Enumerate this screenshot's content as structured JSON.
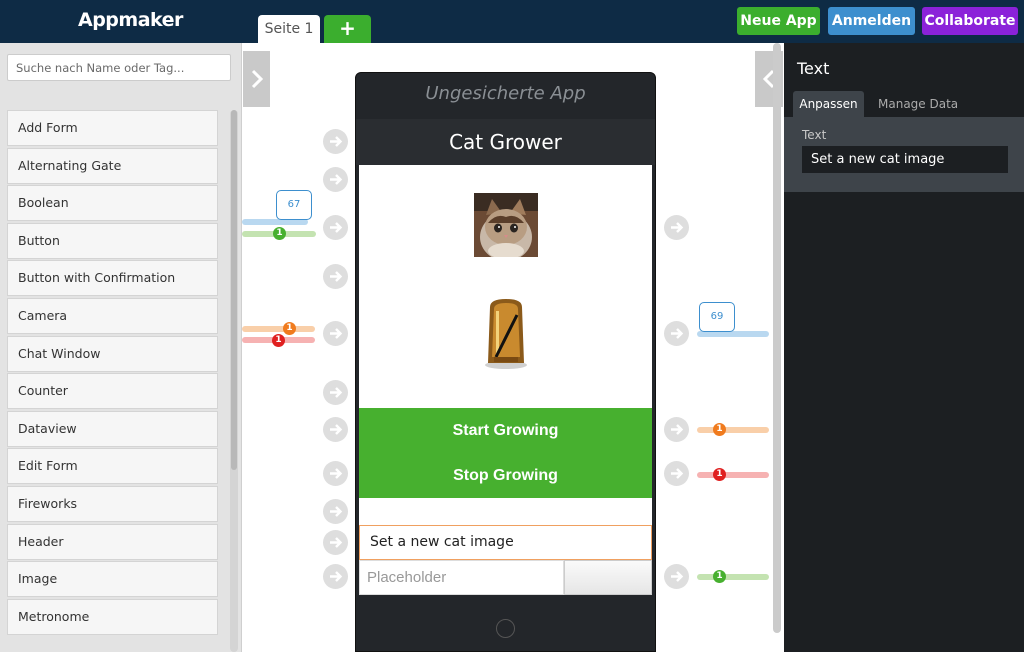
{
  "app": {
    "brand": "Appmaker",
    "page_tab": "Seite 1",
    "add_tab": "+",
    "buttons": {
      "neue_app": "Neue App",
      "anmelden": "Anmelden",
      "collaborate": "Collaborate"
    }
  },
  "sidebar": {
    "search_placeholder": "Suche nach Name oder Tag...",
    "items": [
      {
        "label": "Add Form"
      },
      {
        "label": "Alternating Gate"
      },
      {
        "label": "Boolean"
      },
      {
        "label": "Button"
      },
      {
        "label": "Button with Confirmation"
      },
      {
        "label": "Camera"
      },
      {
        "label": "Chat Window"
      },
      {
        "label": "Counter"
      },
      {
        "label": "Dataview"
      },
      {
        "label": "Edit Form"
      },
      {
        "label": "Fireworks"
      },
      {
        "label": "Header"
      },
      {
        "label": "Image"
      },
      {
        "label": "Metronome"
      }
    ]
  },
  "phone": {
    "title": "Ungesicherte App",
    "header": "Cat Grower",
    "start_button": "Start Growing",
    "stop_button": "Stop Growing",
    "text_value": "Set a new cat image",
    "input_placeholder": "Placeholder"
  },
  "wires": {
    "left_bubble": "67",
    "right_bubble": "69",
    "badge_one": "1"
  },
  "inspector": {
    "title": "Text",
    "tabs": [
      "Anpassen",
      "Manage Data"
    ],
    "field_label": "Text",
    "field_value": "Set a new cat image"
  },
  "colors": {
    "topbar": "#0e2b45",
    "green": "#3bae2e",
    "blue": "#3d8fce",
    "purple": "#8b22d9",
    "orange": "#f07b1e",
    "red": "#e02020"
  }
}
